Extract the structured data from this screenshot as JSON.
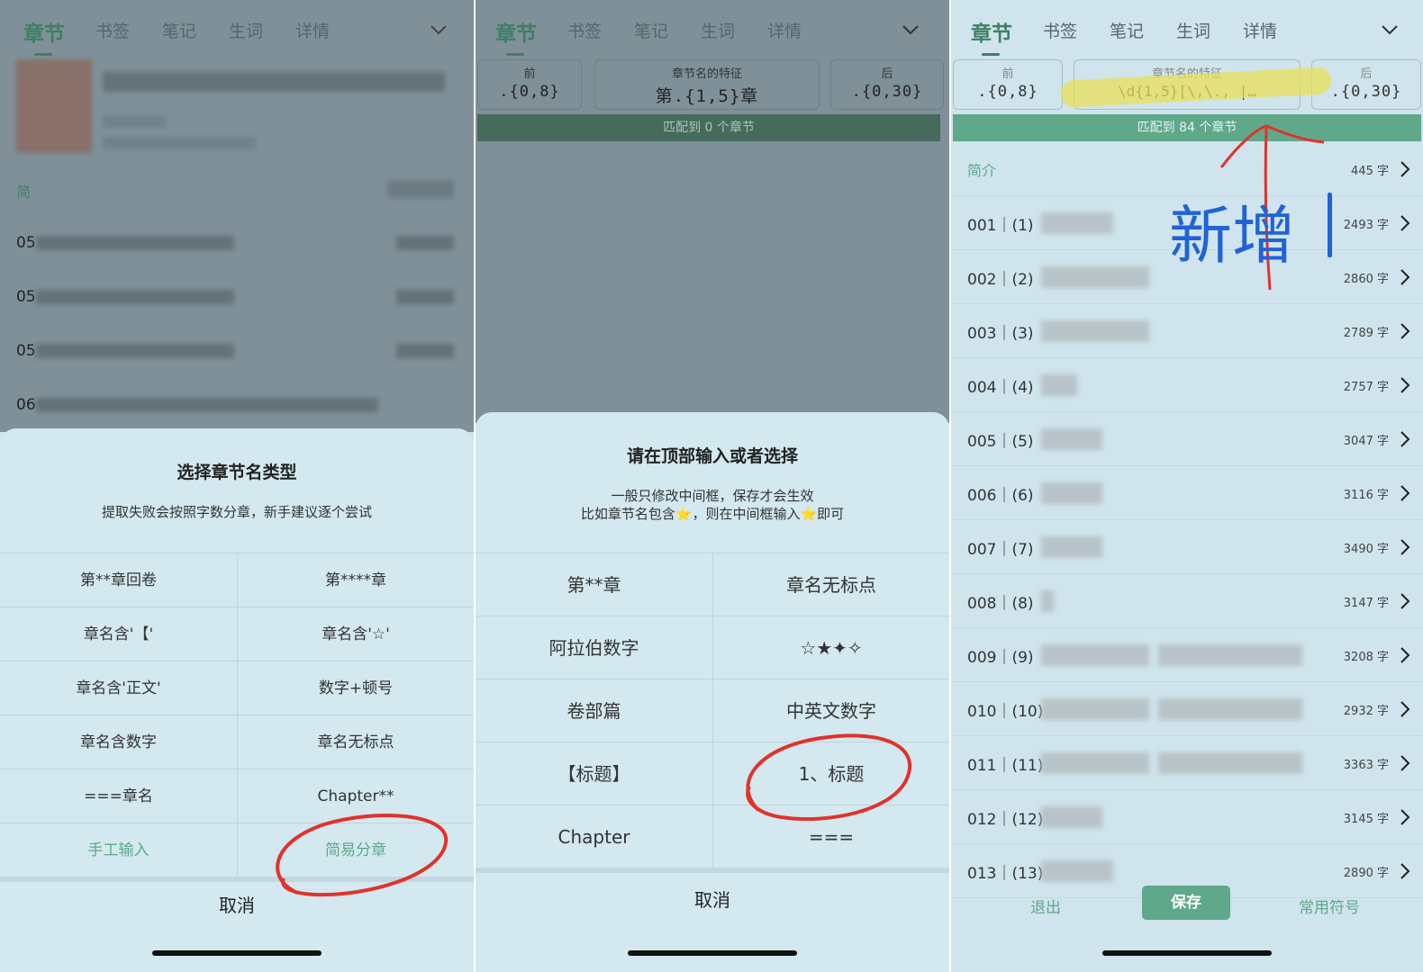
{
  "tabs": [
    "章节",
    "书签",
    "笔记",
    "生词",
    "详情"
  ],
  "panel1": {
    "intro_label": "简",
    "row_prefixes": [
      "05",
      "05",
      "05",
      "06"
    ],
    "sheet_title": "选择章节名类型",
    "sheet_subtitle": "提取失败会按照字数分章，新手建议逐个尝试",
    "options": [
      "第**章回卷",
      "第****章",
      "章名含'【'",
      "章名含'☆'",
      "章名含'正文'",
      "数字+顿号",
      "章名含数字",
      "章名无标点",
      "===章名",
      "Chapter**",
      "手工输入",
      "简易分章"
    ],
    "cancel": "取消"
  },
  "panel2": {
    "field_before_label": "前",
    "field_before_value": ".{0,8}",
    "field_mid_label": "章节名的特征",
    "field_mid_value": "第.{1,5}章",
    "field_after_label": "后",
    "field_after_value": ".{0,30}",
    "match_text": "匹配到 0 个章节",
    "sheet_title": "请在顶部输入或者选择",
    "sheet_line1": "一般只修改中间框，保存才会生效",
    "sheet_line2": "比如章节名包含⭐，则在中间框输入⭐即可",
    "options": [
      "第**章",
      "章名无标点",
      "阿拉伯数字",
      "☆★✦✧",
      "卷部篇",
      "中英文数字",
      "【标题】",
      "1、标题",
      "Chapter",
      "==="
    ],
    "cancel": "取消"
  },
  "panel3": {
    "field_before_label": "前",
    "field_before_value": ".{0,8}",
    "field_mid_label": "章节名的特征",
    "field_mid_value": "\\d{1,5}[\\,\\.,  |…",
    "field_after_label": "后",
    "field_after_value": ".{0,30}",
    "match_text": "匹配到 84 个章节",
    "intro": {
      "label": "简介",
      "count": "445 字"
    },
    "chapters": [
      {
        "num": "001｜(1)",
        "count": "2493 字"
      },
      {
        "num": "002｜(2)",
        "count": "2860 字"
      },
      {
        "num": "003｜(3)",
        "count": "2789 字"
      },
      {
        "num": "004｜(4)",
        "count": "2757 字"
      },
      {
        "num": "005｜(5)",
        "count": "3047 字"
      },
      {
        "num": "006｜(6)",
        "count": "3116 字"
      },
      {
        "num": "007｜(7)",
        "count": "3490 字"
      },
      {
        "num": "008｜(8)",
        "count": "3147 字"
      },
      {
        "num": "009｜(9)",
        "count": "3208 字"
      },
      {
        "num": "010｜(10)",
        "count": "2932 字"
      },
      {
        "num": "011｜(11)",
        "count": "3363 字"
      },
      {
        "num": "012｜(12)",
        "count": "3145 字"
      },
      {
        "num": "013｜(13)",
        "count": "2890 字"
      }
    ],
    "exit": "退出",
    "save": "保存",
    "symbols": "常用符号",
    "annotation": "新增"
  },
  "colors": {
    "accent": "#5fa88a",
    "dark_green": "#3f7f64",
    "panel_bg": "#cfe4ec",
    "annotation_red": "#e0322c",
    "annotation_blue": "#1f63d6",
    "highlight": "#e8e05a"
  }
}
